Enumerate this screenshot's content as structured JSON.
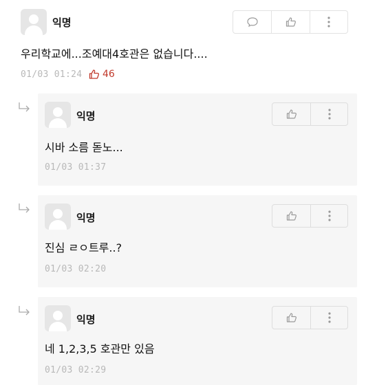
{
  "post": {
    "nickname": "익명",
    "content": "우리학교에...조예대4호관은 없습니다....",
    "time": "01/03 01:24",
    "vote_count": "46",
    "icons": [
      "speech-bubble-icon",
      "thumbs-up-icon",
      "more-vertical-icon"
    ]
  },
  "replies": [
    {
      "nickname": "익명",
      "content": "시바 소름 돋노...",
      "time": "01/03 01:37"
    },
    {
      "nickname": "익명",
      "content": "진심 ㄹㅇ트루..?",
      "time": "01/03 02:20"
    },
    {
      "nickname": "익명",
      "content": "네 1,2,3,5 호관만 있음",
      "time": "01/03 02:29"
    }
  ],
  "colors": {
    "vote": "#c0392b",
    "reply_bg": "#f6f6f6",
    "time": "#b8b8b8"
  }
}
